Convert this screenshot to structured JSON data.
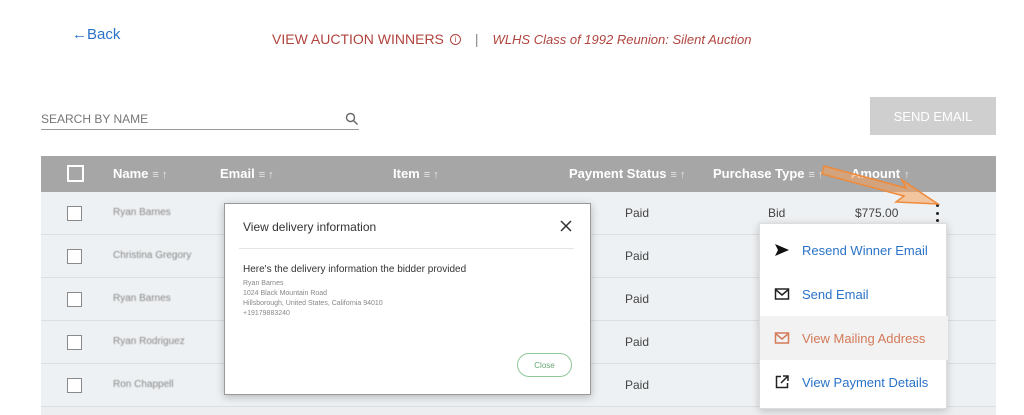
{
  "nav": {
    "back_label": "←Back"
  },
  "header": {
    "title": "VIEW AUCTION WINNERS",
    "info_glyph": "i",
    "separator": "|",
    "subtitle": "WLHS Class of 1992 Reunion: Silent Auction"
  },
  "search": {
    "placeholder": "SEARCH BY NAME"
  },
  "toolbar": {
    "send_email_label": "SEND EMAIL"
  },
  "table": {
    "columns": [
      {
        "label": "Name",
        "arrows": "≡ ↑"
      },
      {
        "label": "Email",
        "arrows": "≡ ↑"
      },
      {
        "label": "Item",
        "arrows": "≡ ↑"
      },
      {
        "label": "Payment Status",
        "arrows": "≡ ↑"
      },
      {
        "label": "Purchase Type",
        "arrows": "≡ ↑"
      },
      {
        "label": "Amount",
        "arrows": "↑"
      }
    ],
    "rows": [
      {
        "name": "Ryan Barnes",
        "payment_status": "Paid",
        "purchase_type": "Bid",
        "amount": "$775.00"
      },
      {
        "name": "Christina Gregory",
        "payment_status": "Paid",
        "purchase_type": "",
        "amount": ""
      },
      {
        "name": "Ryan Barnes",
        "payment_status": "Paid",
        "purchase_type": "",
        "amount": ""
      },
      {
        "name": "Ryan Rodriguez",
        "payment_status": "Paid",
        "purchase_type": "",
        "amount": ""
      },
      {
        "name": "Ron Chappell",
        "payment_status": "Paid",
        "purchase_type": "",
        "amount": ""
      }
    ]
  },
  "modal": {
    "title": "View delivery information",
    "lead": "Here's the delivery information the bidder provided",
    "address": {
      "name": "Ryan Barnes",
      "street": "1024 Black Mountain Road",
      "city_line": "Hillsborough, United States, California 94010",
      "phone": "+19179883240"
    },
    "close_label": "Close"
  },
  "menu": {
    "items": [
      {
        "label": "Resend Winner Email",
        "icon": "send-icon"
      },
      {
        "label": "Send Email",
        "icon": "envelope-icon"
      },
      {
        "label": "View Mailing Address",
        "icon": "envelope-icon"
      },
      {
        "label": "View Payment Details",
        "icon": "external-link-icon"
      }
    ]
  },
  "colors": {
    "link_blue": "#2a73c8",
    "header_red": "#b0443e",
    "active_orange": "#d37a59",
    "table_header_gray": "#a6a6a6",
    "close_green": "#8fc79b",
    "annotation_arrow": "#f5a05a"
  }
}
